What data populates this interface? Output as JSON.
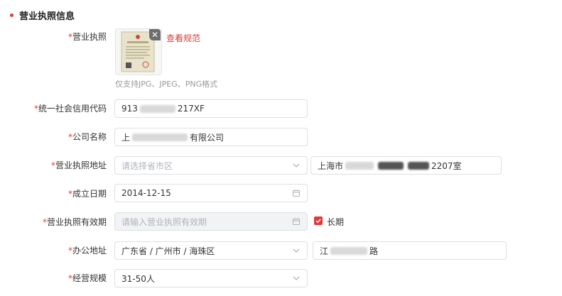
{
  "section": {
    "title": "营业执照信息"
  },
  "license_upload": {
    "label": "营业执照",
    "view_spec_link": "查看规范",
    "hint": "仅支持JPG、JPEG、PNG格式"
  },
  "credit_code": {
    "label": "统一社会信用代码",
    "value_prefix": "913",
    "value_suffix": "217XF"
  },
  "company_name": {
    "label": "公司名称",
    "value_prefix": "上",
    "value_suffix": "有限公司"
  },
  "license_address": {
    "label": "营业执照地址",
    "region_placeholder": "请选择省市区",
    "detail_prefix": "上海市",
    "detail_suffix": "2207室"
  },
  "established_date": {
    "label": "成立日期",
    "value": "2014-12-15"
  },
  "license_validity": {
    "label": "营业执照有效期",
    "placeholder": "请输入营业执照有效期",
    "long_term_label": "长期",
    "long_term_checked": true
  },
  "office_address": {
    "label": "办公地址",
    "region_value": "广东省 / 广州市 / 海珠区",
    "detail_prefix": "江",
    "detail_suffix": "路"
  },
  "business_scale": {
    "label": "经营规模",
    "value": "31-50人"
  },
  "colors": {
    "accent": "#e03a3a",
    "border": "#dcdfe6",
    "placeholder": "#b0b3b8"
  }
}
